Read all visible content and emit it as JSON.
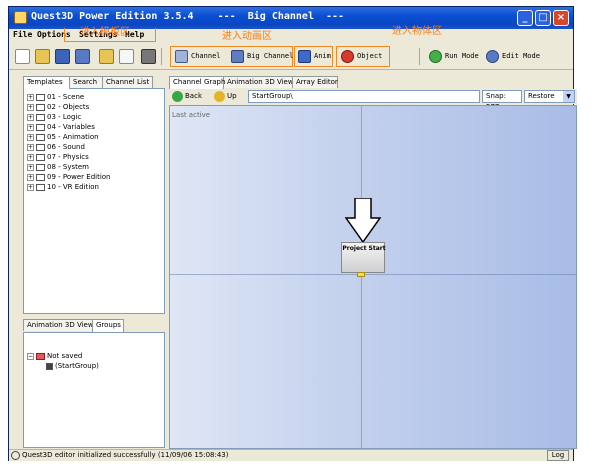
{
  "window": {
    "title": "Quest3D Power Edition 3.5.4    ---  Big Channel  ---",
    "controls": [
      "minimize",
      "maximize",
      "close"
    ]
  },
  "menu": [
    "File",
    "Options",
    "Settings",
    "Help"
  ],
  "toolbar": {
    "channel_label": "Channel",
    "big_channel_label": "Big Channel",
    "anim_label": "Anim",
    "object_label": "Object",
    "run_mode_label": "Run Mode",
    "edit_mode_label": "Edit Mode"
  },
  "annotations": {
    "left": "进入模板区",
    "mid": "进入动画区",
    "right": "进入物体区"
  },
  "left_tabs": [
    "Templates",
    "Search",
    "Channel List"
  ],
  "templates": [
    "01 - Scene",
    "02 - Objects",
    "03 - Logic",
    "04 - Variables",
    "05 - Animation",
    "06 - Sound",
    "07 - Physics",
    "08 - System",
    "09 - Power Edition",
    "10 - VR Edition"
  ],
  "lower_tabs": [
    "Animation 3D View",
    "Groups"
  ],
  "groups": {
    "root": "Not saved",
    "child": "(StartGroup)"
  },
  "right_tabs": [
    "Channel Graph",
    "Animation 3D View",
    "Array Editor"
  ],
  "nav": {
    "back": "Back",
    "up": "Up",
    "path": "StartGroup\\",
    "snap": "Snap: 577",
    "restore": "Restore"
  },
  "graph": {
    "last_active": "Last active",
    "node_label": "Project Start"
  },
  "status": {
    "message": "Quest3D editor initialized successfully (11/09/06 15:08:43)",
    "log_button": "Log"
  },
  "colors": {
    "titlebar": "#0a4fd3",
    "annotation": "#ff7a10",
    "graph_bg": "#b8c9ec"
  }
}
